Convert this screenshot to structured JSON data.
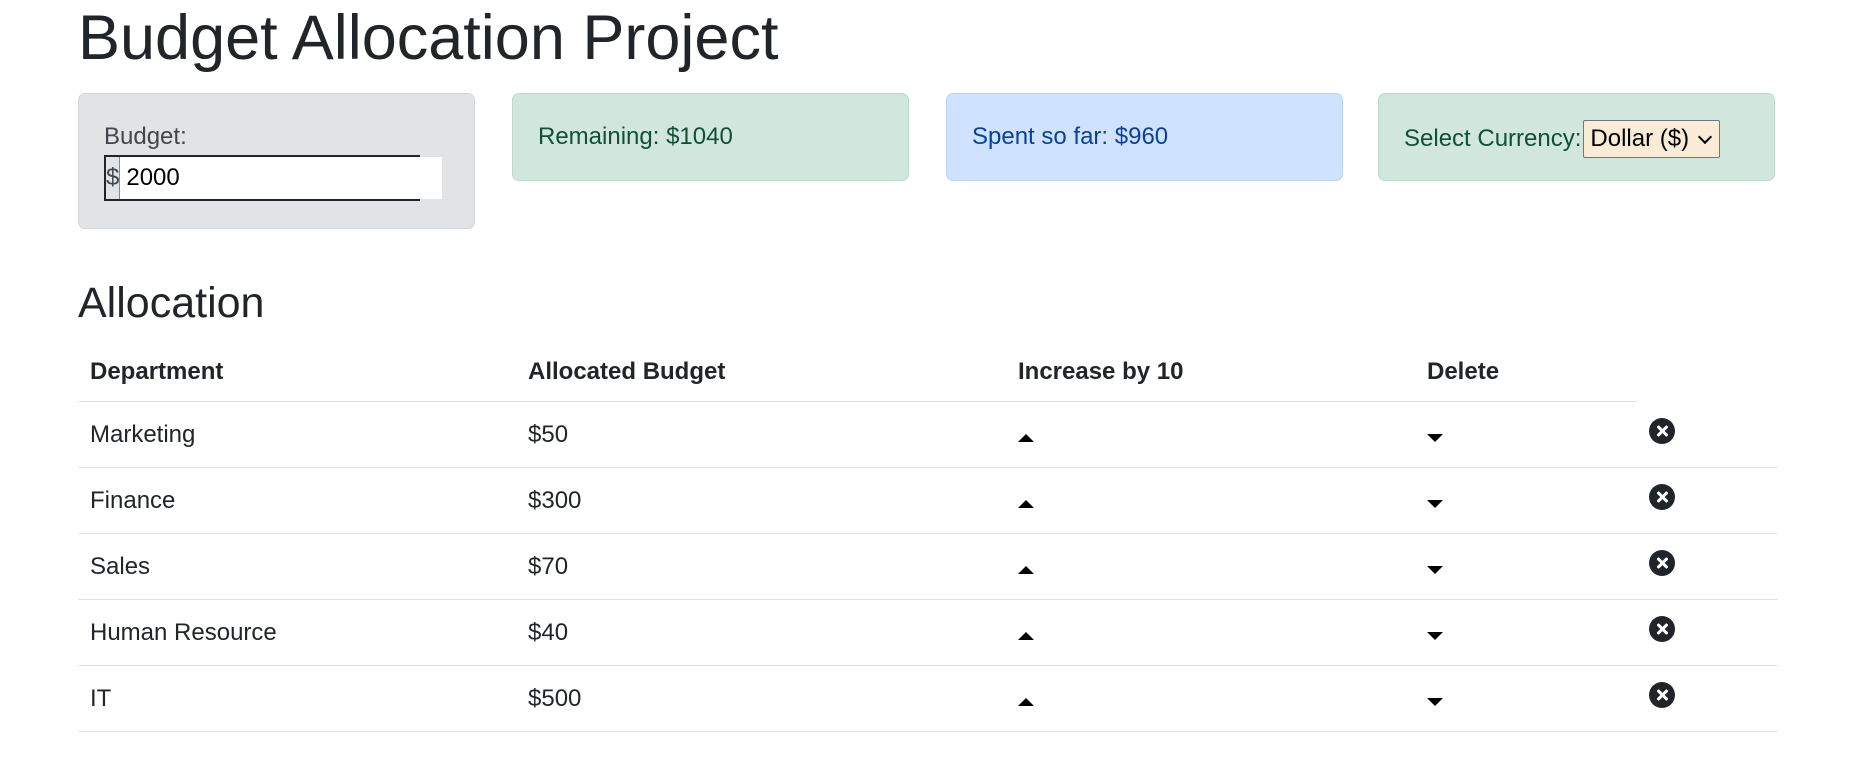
{
  "page": {
    "title": "Budget Allocation Project"
  },
  "budget": {
    "label": "Budget:",
    "currency_symbol": "$",
    "value": "2000"
  },
  "remaining": {
    "text": "Remaining: $1040"
  },
  "spent": {
    "text": "Spent so far: $960"
  },
  "currency": {
    "label": "Select Currency:",
    "selected": "Dollar ($)"
  },
  "allocation": {
    "title": "Allocation",
    "headers": {
      "department": "Department",
      "allocated": "Allocated Budget",
      "increase": "Increase by 10",
      "delete": "Delete"
    },
    "rows": [
      {
        "department": "Marketing",
        "allocated": "$50"
      },
      {
        "department": "Finance",
        "allocated": "$300"
      },
      {
        "department": "Sales",
        "allocated": "$70"
      },
      {
        "department": "Human Resource",
        "allocated": "$40"
      },
      {
        "department": "IT",
        "allocated": "$500"
      }
    ]
  },
  "colors": {
    "budget_card": "#e2e3e5",
    "remaining_card": "#d1e7dd",
    "spent_card": "#cfe2ff",
    "currency_card": "#d1e7dd",
    "currency_select": "#faebd7"
  },
  "icons": {
    "increase": "caret-up-icon",
    "decrease": "caret-down-icon",
    "delete": "x-circle-icon"
  }
}
